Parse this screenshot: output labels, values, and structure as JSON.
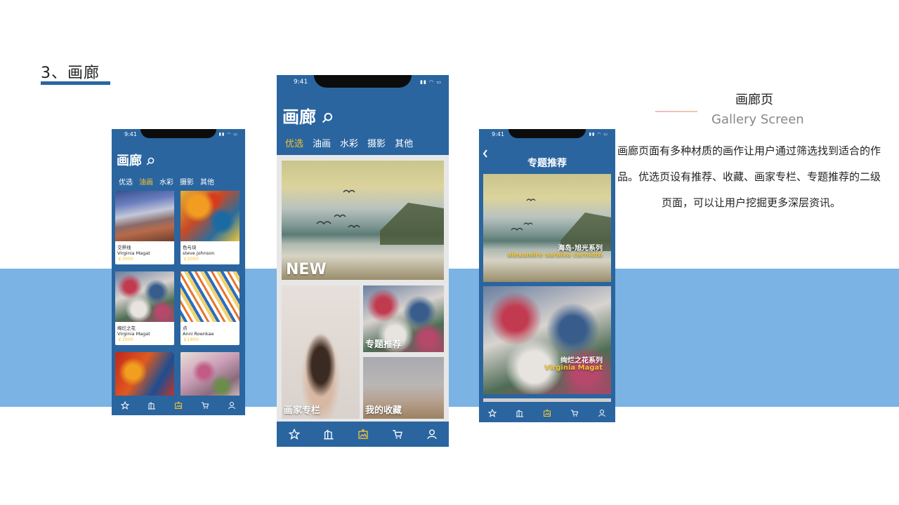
{
  "section": {
    "title": "3、画廊"
  },
  "description": {
    "title": "画廊页",
    "subtitle": "Gallery Screen",
    "body_lines": [
      "画廊页面有多种材质的画作让用户通过筛选找到适合的作",
      "品。优选页设有推荐、收藏、画家专栏、专题推荐的二级",
      "页面，可以让用户挖掘更多深层资讯。"
    ]
  },
  "status_bar": {
    "time": "9:41"
  },
  "phone_left": {
    "title": "画廊",
    "tabs": [
      "优选",
      "油画",
      "水彩",
      "摄影",
      "其他"
    ],
    "active_tab": "油画",
    "cards": [
      {
        "title": "交界线",
        "artist": "Virginia Magat",
        "price": "￥3000"
      },
      {
        "title": "色与块",
        "artist": "steve johnson",
        "price": "￥2000"
      },
      {
        "title": "绚烂之花",
        "artist": "Virginia Magat",
        "price": "￥3000"
      },
      {
        "title": "点",
        "artist": "Anni Roenkae",
        "price": "￥1800"
      }
    ]
  },
  "phone_center": {
    "title": "画廊",
    "tabs": [
      "优选",
      "油画",
      "水彩",
      "摄影",
      "其他"
    ],
    "active_tab": "优选",
    "hero_label": "NEW",
    "tiles": [
      "画家专栏",
      "专题推荐",
      "我的收藏"
    ]
  },
  "phone_right": {
    "header": "专题推荐",
    "items": [
      {
        "title": "海岛·旭光系列",
        "artist": "alexandre saraiva carniato"
      },
      {
        "title": "绚烂之花系列",
        "artist": "Virginia Magat"
      }
    ]
  },
  "tabbar_icons": [
    "star-icon",
    "building-icon",
    "gallery-icon",
    "cart-icon",
    "user-icon"
  ],
  "colors": {
    "primary": "#2a65a0",
    "accent": "#f4c430",
    "band": "#7ab3e4"
  }
}
